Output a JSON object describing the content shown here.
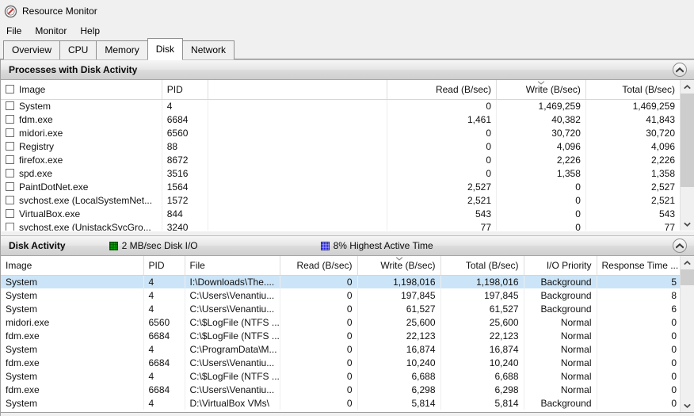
{
  "window": {
    "title": "Resource Monitor",
    "icon": "resource-monitor-icon"
  },
  "menu": {
    "items": [
      {
        "label": "File"
      },
      {
        "label": "Monitor"
      },
      {
        "label": "Help"
      }
    ]
  },
  "tabs": {
    "active": "Disk",
    "items": [
      {
        "label": "Overview"
      },
      {
        "label": "CPU"
      },
      {
        "label": "Memory"
      },
      {
        "label": "Disk"
      },
      {
        "label": "Network"
      }
    ]
  },
  "processes_section": {
    "title": "Processes with Disk Activity",
    "collapse_icon": "chevron-up-icon",
    "columns": [
      {
        "label": "Image",
        "align": "l"
      },
      {
        "label": "PID",
        "align": "l"
      },
      {
        "label": "",
        "align": "l"
      },
      {
        "label": "Read (B/sec)",
        "align": "r"
      },
      {
        "label": "Write (B/sec)",
        "align": "r",
        "sorted": true
      },
      {
        "label": "Total (B/sec)",
        "align": "r"
      }
    ],
    "rows": [
      {
        "image": "System",
        "pid": "4",
        "read": "0",
        "write": "1,469,259",
        "total": "1,469,259"
      },
      {
        "image": "fdm.exe",
        "pid": "6684",
        "read": "1,461",
        "write": "40,382",
        "total": "41,843"
      },
      {
        "image": "midori.exe",
        "pid": "6560",
        "read": "0",
        "write": "30,720",
        "total": "30,720"
      },
      {
        "image": "Registry",
        "pid": "88",
        "read": "0",
        "write": "4,096",
        "total": "4,096"
      },
      {
        "image": "firefox.exe",
        "pid": "8672",
        "read": "0",
        "write": "2,226",
        "total": "2,226"
      },
      {
        "image": "spd.exe",
        "pid": "3516",
        "read": "0",
        "write": "1,358",
        "total": "1,358"
      },
      {
        "image": "PaintDotNet.exe",
        "pid": "1564",
        "read": "2,527",
        "write": "0",
        "total": "2,527"
      },
      {
        "image": "svchost.exe (LocalSystemNet...",
        "pid": "1572",
        "read": "2,521",
        "write": "0",
        "total": "2,521"
      },
      {
        "image": "VirtualBox.exe",
        "pid": "844",
        "read": "543",
        "write": "0",
        "total": "543"
      },
      {
        "image": "svchost.exe (UnistackSvcGro...",
        "pid": "3240",
        "read": "77",
        "write": "0",
        "total": "77"
      }
    ]
  },
  "disk_section": {
    "title": "Disk Activity",
    "collapse_icon": "chevron-up-icon",
    "legend": [
      {
        "swatch": "green",
        "swatch_color": "#00b300",
        "label": "2 MB/sec Disk I/O"
      },
      {
        "swatch": "blue",
        "swatch_color": "#1a1ae0",
        "label": "8% Highest Active Time"
      }
    ],
    "columns": [
      {
        "label": "Image",
        "align": "l"
      },
      {
        "label": "PID",
        "align": "l"
      },
      {
        "label": "File",
        "align": "l"
      },
      {
        "label": "Read (B/sec)",
        "align": "r"
      },
      {
        "label": "Write (B/sec)",
        "align": "r",
        "sorted": true
      },
      {
        "label": "Total (B/sec)",
        "align": "r"
      },
      {
        "label": "I/O Priority",
        "align": "r"
      },
      {
        "label": "Response Time ...",
        "align": "l"
      }
    ],
    "rows": [
      {
        "image": "System",
        "pid": "4",
        "file": "I:\\Downloads\\The....",
        "read": "0",
        "write": "1,198,016",
        "total": "1,198,016",
        "priority": "Background",
        "response": "5",
        "selected": true
      },
      {
        "image": "System",
        "pid": "4",
        "file": "C:\\Users\\Venantiu...",
        "read": "0",
        "write": "197,845",
        "total": "197,845",
        "priority": "Background",
        "response": "8"
      },
      {
        "image": "System",
        "pid": "4",
        "file": "C:\\Users\\Venantiu...",
        "read": "0",
        "write": "61,527",
        "total": "61,527",
        "priority": "Background",
        "response": "6"
      },
      {
        "image": "midori.exe",
        "pid": "6560",
        "file": "C:\\$LogFile (NTFS ...",
        "read": "0",
        "write": "25,600",
        "total": "25,600",
        "priority": "Normal",
        "response": "0"
      },
      {
        "image": "fdm.exe",
        "pid": "6684",
        "file": "C:\\$LogFile (NTFS ...",
        "read": "0",
        "write": "22,123",
        "total": "22,123",
        "priority": "Normal",
        "response": "0"
      },
      {
        "image": "System",
        "pid": "4",
        "file": "C:\\ProgramData\\M...",
        "read": "0",
        "write": "16,874",
        "total": "16,874",
        "priority": "Normal",
        "response": "0"
      },
      {
        "image": "fdm.exe",
        "pid": "6684",
        "file": "C:\\Users\\Venantiu...",
        "read": "0",
        "write": "10,240",
        "total": "10,240",
        "priority": "Normal",
        "response": "0"
      },
      {
        "image": "System",
        "pid": "4",
        "file": "C:\\$LogFile (NTFS ...",
        "read": "0",
        "write": "6,688",
        "total": "6,688",
        "priority": "Normal",
        "response": "0"
      },
      {
        "image": "fdm.exe",
        "pid": "6684",
        "file": "C:\\Users\\Venantiu...",
        "read": "0",
        "write": "6,298",
        "total": "6,298",
        "priority": "Normal",
        "response": "0"
      },
      {
        "image": "System",
        "pid": "4",
        "file": "D:\\VirtualBox VMs\\",
        "read": "0",
        "write": "5,814",
        "total": "5,814",
        "priority": "Background",
        "response": "0"
      }
    ]
  }
}
